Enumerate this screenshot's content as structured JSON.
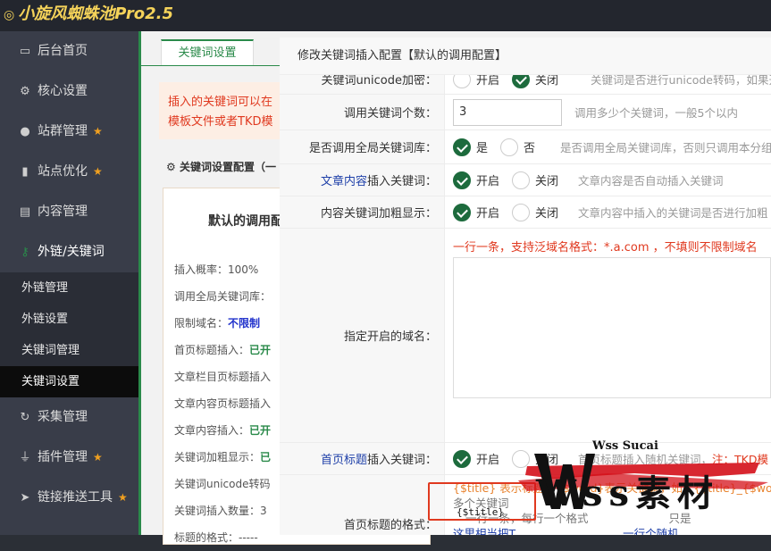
{
  "app": {
    "title": "小旋风蜘蛛池Pro2.5"
  },
  "sidebar": {
    "items": [
      {
        "label": "后台首页",
        "icon": "monitor-icon"
      },
      {
        "label": "核心设置",
        "icon": "gear-icon"
      },
      {
        "label": "站群管理",
        "icon": "user-icon"
      },
      {
        "label": "站点优化",
        "icon": "bar-chart-icon"
      },
      {
        "label": "内容管理",
        "icon": "document-icon"
      },
      {
        "label": "外链/关键词",
        "icon": "key-icon"
      },
      {
        "label": "采集管理",
        "icon": "refresh-icon"
      },
      {
        "label": "插件管理",
        "icon": "plug-icon"
      },
      {
        "label": "链接推送工具",
        "icon": "send-icon"
      }
    ],
    "subitems": [
      "外链管理",
      "外链设置",
      "关键词管理",
      "关键词设置"
    ]
  },
  "main": {
    "tab": "关键词设置",
    "warning_line1": "插入的关键词可以在",
    "warning_line2": "模板文件或者TKD模",
    "config_title": "关键词设置配置（一",
    "card": {
      "title": "默认的调用配",
      "rows": [
        {
          "label": "插入概率：",
          "value": "100%"
        },
        {
          "label": "调用全局关键词库：",
          "value": ""
        },
        {
          "label": "限制域名：",
          "value": "不限制"
        },
        {
          "label": "首页标题插入：",
          "value": "已开"
        },
        {
          "label": "文章栏目页标题插入",
          "value": ""
        },
        {
          "label": "文章内容页标题插入",
          "value": ""
        },
        {
          "label": "文章内容插入：",
          "value": "已开"
        },
        {
          "label": "关键词加粗显示：",
          "value": "已"
        },
        {
          "label": "关键词unicode转码",
          "value": ""
        },
        {
          "label": "关键词插入数量：",
          "value": "3"
        },
        {
          "label": "标题的格式：",
          "value": "-----"
        }
      ]
    }
  },
  "dialog": {
    "title": "修改关键词插入配置【默认的调用配置】",
    "rows": {
      "unicode": {
        "label": "关键词unicode加密：",
        "on": "开启",
        "off": "关闭",
        "hint": "关键词是否进行unicode转码，如果开"
      },
      "count": {
        "label": "调用关键词个数：",
        "value": "3",
        "hint": "调用多少个关键词，一般5个以内"
      },
      "global": {
        "label": "是否调用全局关键词库：",
        "on": "是",
        "off": "否",
        "hint": "是否调用全局关键词库，否则只调用本分组"
      },
      "article": {
        "label_blue": "文章内容",
        "label_rest": "插入关键词：",
        "on": "开启",
        "off": "关闭",
        "hint": "文章内容是否自动插入关键词"
      },
      "bold": {
        "label": "内容关键词加粗显示：",
        "on": "开启",
        "off": "关闭",
        "hint": "文章内容中插入的关键词是否进行加粗"
      },
      "domain": {
        "label": "指定开启的域名：",
        "hint": "一行一条，支持泛域名格式：*.a.com ，不填则不限制域名"
      },
      "index_title": {
        "label_blue": "首页标题",
        "label_rest": "插入关键词：",
        "on": "开启",
        "off": "关闭",
        "hint": "首页标题插入随机关键词，",
        "hint_red": "注：TKD模"
      },
      "format": {
        "label": "首页标题的格式：",
        "help1": "{$title} 表示标题，{$word}表示关键词，如：{$title}_{$word}",
        "help2": "多个关键词",
        "help3": "一行一条，每行一个格式",
        "help3_tail": "只是",
        "help4": "这里相当把T",
        "help4_tail": "一行个随机",
        "value": "{$title}"
      }
    }
  },
  "watermark": {
    "small": "Wss Sucai",
    "big": "Wss素材"
  }
}
